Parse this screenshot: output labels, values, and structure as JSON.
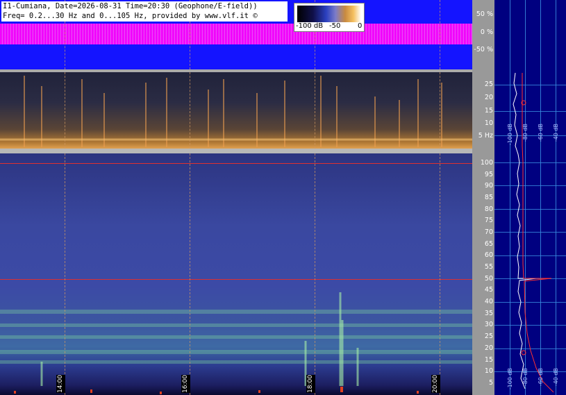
{
  "header": {
    "line1": "I1-Cumiana, Date=2026-08-31 Time=20:30 (Geophone/E-field))",
    "line2": "Freq= 0.2...30 Hz and 0...105 Hz, provided by www.vlf.it ©"
  },
  "legend": {
    "labels": [
      "-100 dB",
      "-50",
      "0"
    ]
  },
  "waveform_axis": [
    "50 %",
    "0 %",
    "-50 %"
  ],
  "low_freq_axis": [
    "25",
    "20",
    "15",
    "10",
    "5 Hz"
  ],
  "main_freq_axis": [
    "100",
    "95",
    "90",
    "85",
    "80",
    "75",
    "70",
    "65",
    "60",
    "55",
    "50",
    "45",
    "40",
    "35",
    "30",
    "25",
    "20",
    "15",
    "10",
    "5"
  ],
  "time_labels": [
    "14:00",
    "16:00",
    "18:00",
    "20:00"
  ],
  "profile_db_labels": [
    "-100 dB",
    "-80 dB",
    "-60 dB",
    "-40 dB",
    "-20 dB"
  ],
  "colors": {
    "waveform_bg": "#1414ff",
    "waveform_signal": "#ff00ff",
    "profile_bg": "#000080",
    "grid_line": "#d39a60",
    "mains_line": "#e03030"
  }
}
